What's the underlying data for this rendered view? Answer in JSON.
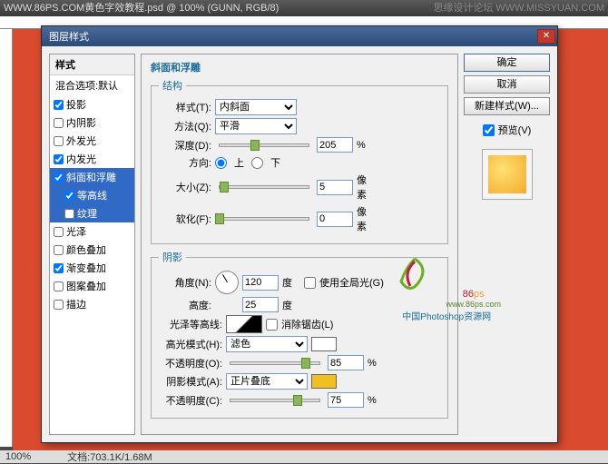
{
  "app": {
    "title": "WWW.86PS.COM黄色字效教程.psd @ 100% (GUNN, RGB/8)",
    "forum": "思缘设计论坛",
    "url": "WWW.MISSYUAN.COM"
  },
  "statusbar": {
    "zoom": "100%",
    "doc": "文档:703.1K/1.68M"
  },
  "dialog": {
    "title": "图层样式",
    "styles_header": "样式",
    "blend_options": "混合选项:默认",
    "items": [
      {
        "label": "投影",
        "checked": true
      },
      {
        "label": "内阴影",
        "checked": false
      },
      {
        "label": "外发光",
        "checked": false
      },
      {
        "label": "内发光",
        "checked": true
      },
      {
        "label": "斜面和浮雕",
        "checked": true,
        "selected": true
      },
      {
        "label": "等高线",
        "checked": true,
        "sub": true,
        "selected": true
      },
      {
        "label": "纹理",
        "checked": false,
        "sub": true,
        "selected": true
      },
      {
        "label": "光泽",
        "checked": false
      },
      {
        "label": "颜色叠加",
        "checked": false
      },
      {
        "label": "渐变叠加",
        "checked": true
      },
      {
        "label": "图案叠加",
        "checked": false
      },
      {
        "label": "描边",
        "checked": false
      }
    ],
    "section_title": "斜面和浮雕",
    "structure": {
      "legend": "结构",
      "style_label": "样式(T):",
      "style_value": "内斜面",
      "method_label": "方法(Q):",
      "method_value": "平滑",
      "depth_label": "深度(D):",
      "depth_value": "205",
      "depth_unit": "%",
      "direction_label": "方向:",
      "dir_up": "上",
      "dir_down": "下",
      "size_label": "大小(Z):",
      "size_value": "5",
      "size_unit": "像素",
      "soften_label": "软化(F):",
      "soften_value": "0",
      "soften_unit": "像素"
    },
    "shading": {
      "legend": "阴影",
      "angle_label": "角度(N):",
      "angle_value": "120",
      "angle_unit": "度",
      "global_label": "使用全局光(G)",
      "altitude_label": "高度:",
      "altitude_value": "25",
      "altitude_unit": "度",
      "contour_label": "光泽等高线:",
      "antialias_label": "消除锯齿(L)",
      "hilite_mode_label": "高光模式(H):",
      "hilite_mode_value": "滤色",
      "opacity1_label": "不透明度(O):",
      "opacity1_value": "85",
      "opacity1_unit": "%",
      "shadow_mode_label": "阴影模式(A):",
      "shadow_mode_value": "正片叠底",
      "opacity2_label": "不透明度(C):",
      "opacity2_value": "75",
      "opacity2_unit": "%"
    },
    "buttons": {
      "ok": "确定",
      "cancel": "取消",
      "newstyle": "新建样式(W)...",
      "preview": "预览(V)"
    }
  },
  "logo": {
    "brand": "86",
    "suffix": "ps",
    "url": "www.86ps.com",
    "cn": "中国Photoshop资源网"
  }
}
